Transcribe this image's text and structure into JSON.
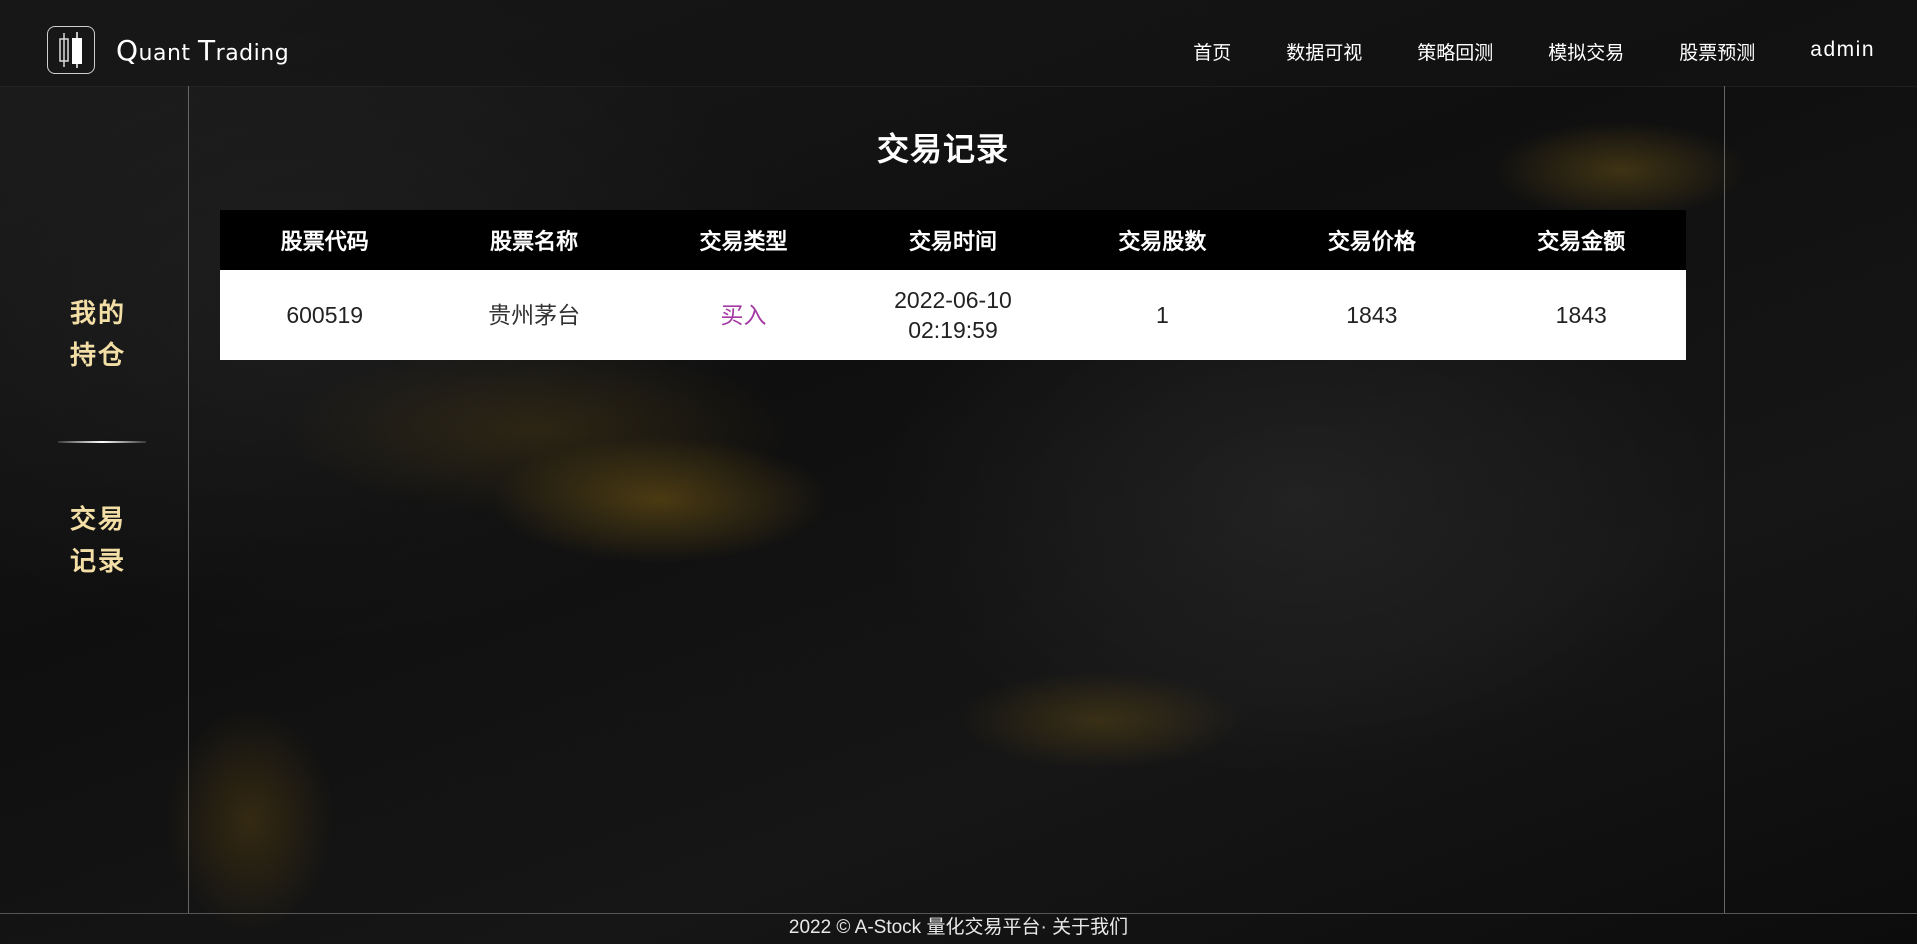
{
  "header": {
    "logo_q": "Q",
    "logo_uant": "uant ",
    "logo_t": "T",
    "logo_rading": "rading",
    "nav": [
      {
        "label": "首页"
      },
      {
        "label": "数据可视"
      },
      {
        "label": "策略回测"
      },
      {
        "label": "模拟交易"
      },
      {
        "label": "股票预测"
      }
    ],
    "user": "admin"
  },
  "sidebar": {
    "holdings_line1": "我的",
    "holdings_line2": "持仓",
    "records_line1": "交易",
    "records_line2": "记录"
  },
  "main": {
    "title": "交易记录",
    "columns": [
      "股票代码",
      "股票名称",
      "交易类型",
      "交易时间",
      "交易股数",
      "交易价格",
      "交易金额"
    ],
    "rows": [
      {
        "code": "600519",
        "name": "贵州茅台",
        "type": "买入",
        "date": "2022-06-10",
        "time": "02:19:59",
        "shares": "1",
        "price": "1843",
        "amount": "1843"
      }
    ]
  },
  "footer": {
    "copyright": "2022 © A-Stock 量化交易平台· ",
    "about": "关于我们"
  },
  "colors": {
    "sidebar_text": "#f3dfa6",
    "buy_type": "#a43aa3",
    "table_header_bg": "#000000",
    "table_body_bg": "#ffffff"
  }
}
